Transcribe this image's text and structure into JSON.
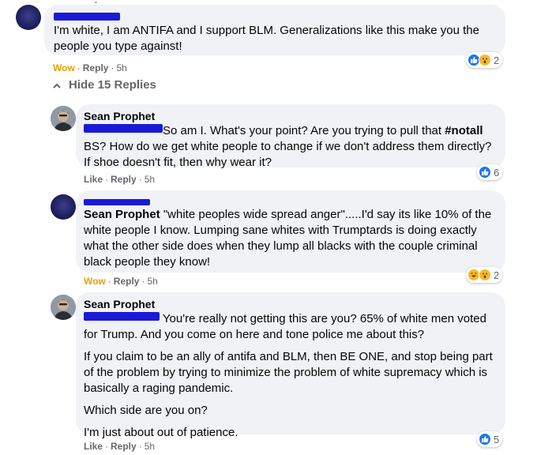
{
  "top_comment": {
    "text": "I'm white, I am ANTIFA and I support BLM. Generalizations like this make you the people you type against!",
    "reaction_label": "Wow",
    "reply_label": "Reply",
    "time": "5h",
    "reaction_count": "2"
  },
  "hide_replies": "Hide 15 Replies",
  "replies": [
    {
      "author": "Sean Prophet",
      "text_rest": "So am I. What's your point? Are you trying to pull that ",
      "hashtag": "#notall",
      "text_rest2": " BS? How do we get white people to change if we don't address them directly? If shoe doesn't fit, then why wear it?",
      "reaction_label": "Like",
      "reply_label": "Reply",
      "time": "5h",
      "reaction_count": "6"
    },
    {
      "mention": "Sean Prophet",
      "text_rest": " \"white peoples wide spread anger\".....I'd say its like 10% of the white people I know. Lumping sane whites with Trumptards is doing exactly what the other side does when they lump all blacks with the couple criminal black people they know!",
      "reaction_label": "Wow",
      "reply_label": "Reply",
      "time": "5h",
      "reaction_count": "2"
    },
    {
      "author": "Sean Prophet",
      "p1_rest": " You're really not getting this are you? 65% of white men voted for Trump. And you come on here and tone police me about this?",
      "p2": "If you claim to be an ally of antifa and BLM, then BE ONE, and stop being part of the problem by trying to minimize the problem of white supremacy which is basically a raging pandemic.",
      "p3": "Which side are you on?",
      "p4": "I'm just about out of patience.",
      "reaction_label": "Like",
      "reply_label": "Reply",
      "time": "5h",
      "reaction_count": "5"
    }
  ],
  "colors": {
    "bubble": "#f0f2f5",
    "like": "#1877f2",
    "wow": "#f7b928",
    "redaction": "#1a1ad6",
    "meta_text": "#65676b"
  }
}
